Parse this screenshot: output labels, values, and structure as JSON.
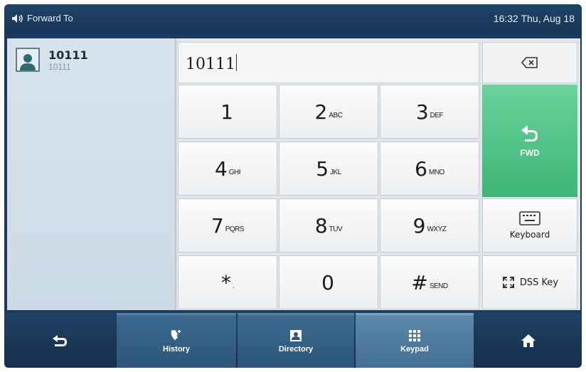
{
  "header": {
    "title": "Forward To",
    "clock": "16:32 Thu, Aug 18"
  },
  "contact": {
    "name": "10111",
    "number": "10111"
  },
  "entry": {
    "value": "10111"
  },
  "keypad": {
    "k1": {
      "digit": "1",
      "letters": ""
    },
    "k2": {
      "digit": "2",
      "letters": "ABC"
    },
    "k3": {
      "digit": "3",
      "letters": "DEF"
    },
    "k4": {
      "digit": "4",
      "letters": "GHI"
    },
    "k5": {
      "digit": "5",
      "letters": "JKL"
    },
    "k6": {
      "digit": "6",
      "letters": "MNO"
    },
    "k7": {
      "digit": "7",
      "letters": "PQRS"
    },
    "k8": {
      "digit": "8",
      "letters": "TUV"
    },
    "k9": {
      "digit": "9",
      "letters": "WXYZ"
    },
    "kstar": {
      "digit": "*",
      "letters": "."
    },
    "k0": {
      "digit": "0",
      "letters": ""
    },
    "khash": {
      "digit": "#",
      "letters": "SEND"
    }
  },
  "side_keys": {
    "fwd": "FWD",
    "keyboard": "Keyboard",
    "dss": "DSS Key"
  },
  "tabs": {
    "history": "History",
    "directory": "Directory",
    "keypad": "Keypad"
  },
  "colors": {
    "header_bg": "#1e4266",
    "fwd_green": "#4cc185",
    "tab_selected": "#5b88ab"
  },
  "icons": [
    "speaker-icon",
    "contact-avatar-icon",
    "backspace-icon",
    "forward-icon",
    "keyboard-icon",
    "dss-key-icon",
    "back-icon",
    "history-icon",
    "directory-icon",
    "keypad-icon",
    "home-icon"
  ]
}
